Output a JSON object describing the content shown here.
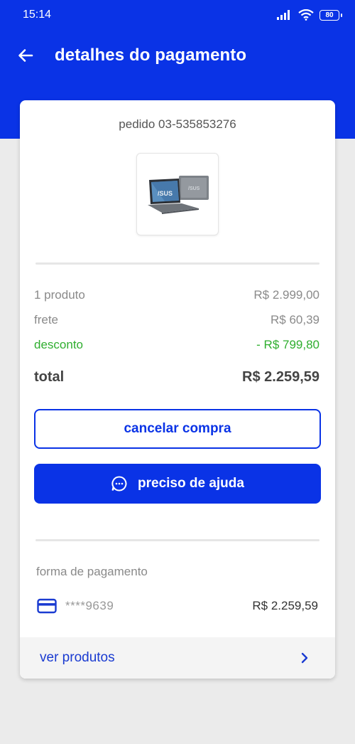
{
  "status_bar": {
    "time": "15:14",
    "battery": "80"
  },
  "header": {
    "title": "detalhes do pagamento"
  },
  "order": {
    "id_label": "pedido 03-535853276",
    "product_image": "laptop-asus-thumbnail"
  },
  "summary": {
    "rows": [
      {
        "label": "1 produto",
        "value": "R$ 2.999,00"
      },
      {
        "label": "frete",
        "value": "R$ 60,39"
      },
      {
        "label": "desconto",
        "value": "- R$ 799,80"
      }
    ],
    "total_label": "total",
    "total_value": "R$ 2.259,59"
  },
  "actions": {
    "cancel_label": "cancelar compra",
    "help_label": "preciso de ajuda"
  },
  "payment": {
    "section_label": "forma de pagamento",
    "card_masked": "****9639",
    "amount": "R$ 2.259,59",
    "icon": "credit-card-icon"
  },
  "footer": {
    "link_label": "ver produtos"
  },
  "colors": {
    "brand_blue": "#0a33e6",
    "discount_green": "#2fae2f",
    "background": "#ebebeb"
  }
}
